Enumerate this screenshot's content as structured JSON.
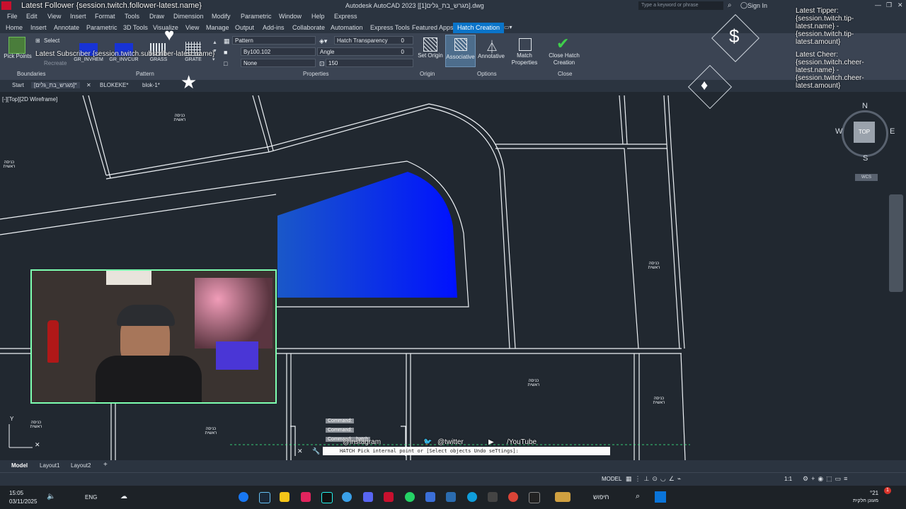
{
  "title_bar": {
    "app_title": "Autodesk AutoCAD 2023  [מגרש_בת_גלים[1]].dwg",
    "search_placeholder": "Type a keyword or phrase",
    "sign_in": "Sign In"
  },
  "menus": [
    "File",
    "Edit",
    "View",
    "Insert",
    "Format",
    "Tools",
    "Draw",
    "Dimension",
    "Modify",
    "Parametric",
    "Window",
    "Help",
    "Express"
  ],
  "ribbon_tabs": [
    "Home",
    "Insert",
    "Annotate",
    "Parametric",
    "3D Tools",
    "Visualize",
    "View",
    "Manage",
    "Output",
    "Add-ins",
    "Collaborate",
    "Automation",
    "Express Tools",
    "Featured Apps",
    "Hatch Creation"
  ],
  "ribbon": {
    "pick_points": "Pick Points",
    "select": "Select",
    "recreate": "Recreate",
    "boundaries": "Boundaries",
    "pattern_panel": "Pattern",
    "patterns": [
      "GR_INVHEM",
      "GR_INVCUR",
      "GRASS",
      "GRATE"
    ],
    "pattern_type": "Pattern",
    "color_value": "By100.102",
    "background": "None",
    "hatch_transparency_label": "Hatch Transparency",
    "hatch_transparency_value": "0",
    "angle_label": "Angle",
    "angle_value": "0",
    "scale_value": "150",
    "properties_panel": "Properties",
    "set_origin": "Set Origin",
    "origin_panel": "Origin",
    "associative": "Associative",
    "annotative": "Annotative",
    "match_properties": "Match Properties",
    "options_panel": "Options",
    "close_hatch": "Close Hatch Creation",
    "close_panel": "Close"
  },
  "doc_tabs": [
    "Start",
    "[מגרש_בת_גלים]*",
    "BLOKEKE*",
    "blok-1*"
  ],
  "viewport_label": "[-][Top][2D Wireframe]",
  "viewcube": {
    "n": "N",
    "s": "S",
    "e": "E",
    "w": "W",
    "top": "TOP",
    "wcs": "WCS"
  },
  "drawing_labels": [
    "כניסה ראשית",
    "כניסה ראשית",
    "כניסה ראשית",
    "כניסה ראשית",
    "כניסה ראשית",
    "כניסה ראשית",
    "כניסה ראשית"
  ],
  "command_history": [
    "Command:",
    "Command:",
    "Command: _hatch"
  ],
  "command_prompt": "HATCH Pick internal point or [Select objects Undo seTtings]:",
  "layout_tabs": [
    "Model",
    "Layout1",
    "Layout2"
  ],
  "status": {
    "model": "MODEL",
    "scale": "1:1"
  },
  "taskbar": {
    "time": "15:05",
    "date": "03/11/2025",
    "lang": "ENG",
    "search": "חיפוש",
    "weather_temp": "°21",
    "weather_desc": "מעונן חלקית"
  },
  "stream_overlay": {
    "latest_follower": "Latest Follower {session.twitch.follower-latest.name}",
    "latest_subscriber": "Latest Subscriber {session.twitch.subscriber-latest.name}",
    "latest_tipper": "Latest Tipper: {session.twitch.tip-latest.name} - {session.twitch.tip-latest.amount}",
    "latest_cheer": "Latest Cheer: {session.twitch.cheer-latest.name} - {session.twitch.cheer-latest.amount}",
    "instagram": "@instagram",
    "twitter": "@twitter",
    "youtube": "/YouTube"
  },
  "colors": {
    "accent": "#0a74c9",
    "hatch_start": "#1a58c8",
    "hatch_end": "#0011ff",
    "overlay_green": "#3cff8a"
  }
}
